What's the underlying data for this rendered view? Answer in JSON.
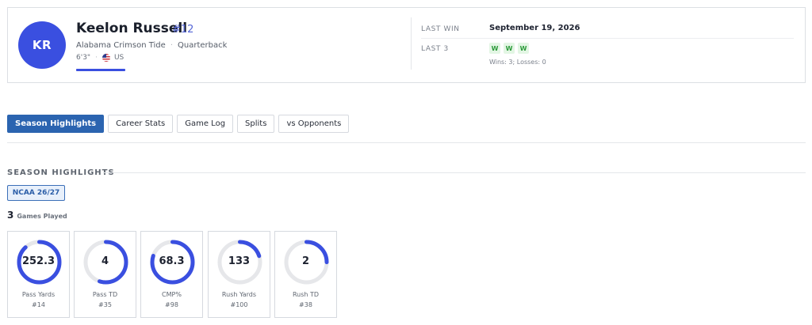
{
  "player": {
    "initials": "KR",
    "name": "Keelon Russell",
    "number": "#12",
    "team": "Alabama Crimson Tide",
    "separator": "·",
    "position": "Quarterback",
    "height": "6'3\"",
    "country": "US",
    "accent_color": "#3a4fe0"
  },
  "summary": {
    "last_win_label": "LAST WIN",
    "last_win_date": "September 19, 2026",
    "last_3_label": "LAST 3",
    "last_3_results": [
      "W",
      "W",
      "W"
    ],
    "record_text": "Wins: 3; Losses: 0"
  },
  "tabs": [
    {
      "label": "Season Highlights",
      "active": true
    },
    {
      "label": "Career Stats",
      "active": false
    },
    {
      "label": "Game Log",
      "active": false
    },
    {
      "label": "Splits",
      "active": false
    },
    {
      "label": "vs Opponents",
      "active": false
    }
  ],
  "highlights": {
    "section_title": "SEASON HIGHLIGHTS",
    "season": "NCAA 26/27",
    "games_played": "3",
    "games_played_label": "Games Played",
    "ring_color": "#3a4fe0",
    "ring_track_color": "#e6e7ea",
    "stats": [
      {
        "value": "252.3",
        "label": "Pass Yards",
        "rank": "#14",
        "fill": 0.88
      },
      {
        "value": "4",
        "label": "Pass TD",
        "rank": "#35",
        "fill": 0.55
      },
      {
        "value": "68.3",
        "label": "CMP%",
        "rank": "#98",
        "fill": 0.8
      },
      {
        "value": "133",
        "label": "Rush Yards",
        "rank": "#100",
        "fill": 0.2
      },
      {
        "value": "2",
        "label": "Rush TD",
        "rank": "#38",
        "fill": 0.25
      }
    ]
  }
}
